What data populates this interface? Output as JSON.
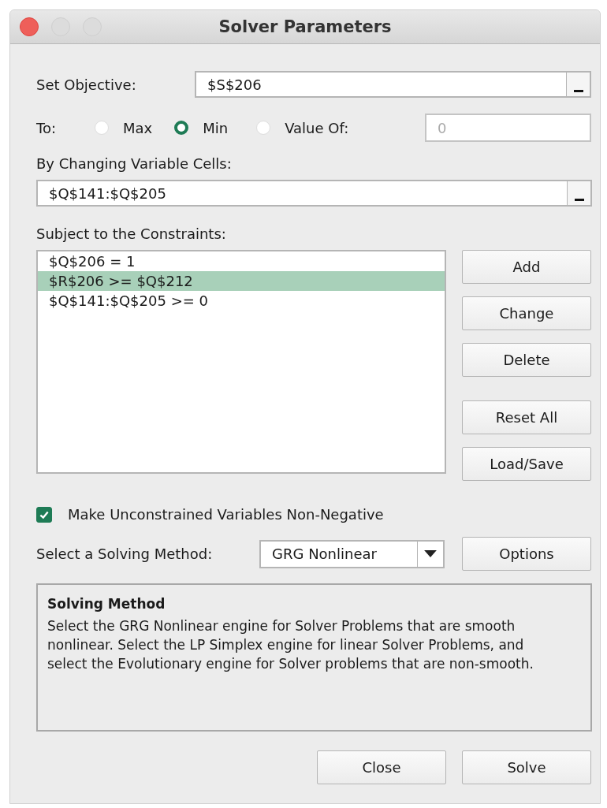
{
  "window": {
    "title": "Solver Parameters",
    "controls": [
      {
        "kind": "close",
        "active": true
      },
      {
        "kind": "minimize",
        "active": false
      },
      {
        "kind": "zoom",
        "active": false
      }
    ]
  },
  "objective": {
    "label": "Set Objective:",
    "value": "$S$206"
  },
  "to": {
    "label": "To:",
    "options": [
      {
        "label": "Max",
        "selected": false
      },
      {
        "label": "Min",
        "selected": true
      },
      {
        "label": "Value Of:",
        "selected": false
      }
    ],
    "value_field": {
      "value": "0",
      "disabled": true
    }
  },
  "variables": {
    "label": "By Changing Variable Cells:",
    "value": "$Q$141:$Q$205"
  },
  "constraints": {
    "label": "Subject to the Constraints:",
    "items": [
      {
        "text": "$Q$206 = 1",
        "selected": false
      },
      {
        "text": "$R$206 >= $Q$212",
        "selected": true
      },
      {
        "text": "$Q$141:$Q$205 >= 0",
        "selected": false
      }
    ],
    "button_groups": [
      {
        "buttons": [
          "Add",
          "Change",
          "Delete"
        ]
      },
      {
        "buttons": [
          "Reset All",
          "Load/Save"
        ]
      }
    ]
  },
  "nonnegative": {
    "label": "Make Unconstrained Variables Non-Negative",
    "checked": true
  },
  "method": {
    "label": "Select a Solving Method:",
    "value": "GRG Nonlinear",
    "options_button": "Options"
  },
  "description": {
    "title": "Solving Method",
    "text": "Select the GRG Nonlinear engine for Solver Problems that are smooth nonlinear. Select the LP Simplex engine for linear Solver Problems, and select the Evolutionary engine for Solver problems that are non-smooth."
  },
  "buttons": [
    "Close",
    "Solve"
  ]
}
